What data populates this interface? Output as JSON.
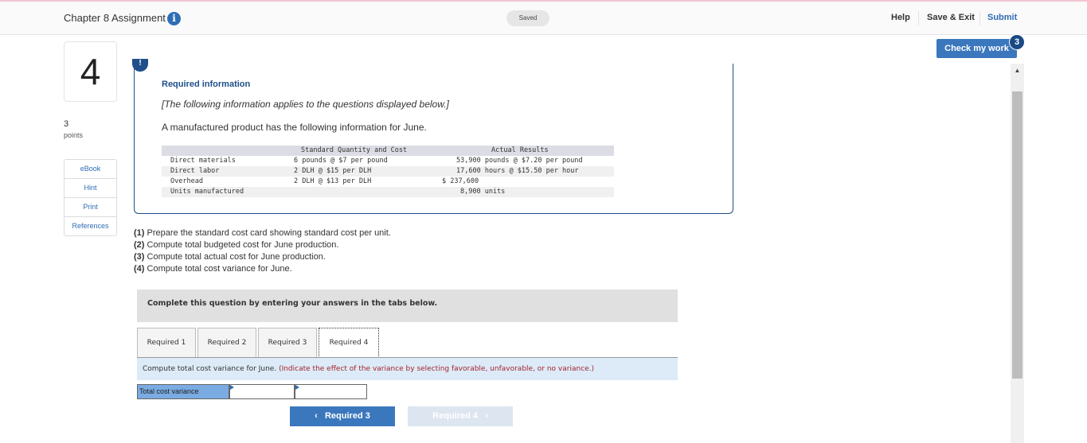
{
  "header": {
    "title": "Chapter 8 Assignment",
    "info_icon": "i",
    "status": "Saved",
    "links": [
      "Help",
      "Save & Exit",
      "Submit"
    ]
  },
  "check_work": {
    "label": "Check my work",
    "badge": "3"
  },
  "question": {
    "number": "4",
    "points_value": "3",
    "points_label": "points",
    "tools": [
      "eBook",
      "Hint",
      "Print",
      "References"
    ]
  },
  "required_info": {
    "alert_icon": "!",
    "heading": "Required information",
    "italic_note": "[The following information applies to the questions displayed below.]",
    "intro": "A manufactured product has the following information for June.",
    "table": {
      "headers": [
        "",
        "Standard Quantity and Cost",
        "Actual Results"
      ],
      "rows": [
        [
          "Direct materials",
          "6 pounds @ $7 per pound",
          "53,900 pounds @ $7.20 per pound"
        ],
        [
          "Direct labor",
          "2 DLH @ $15 per DLH",
          "17,600 hours @ $15.50 per hour"
        ],
        [
          "Overhead",
          "2 DLH @ $13 per DLH",
          "$ 237,600"
        ],
        [
          "Units manufactured",
          "",
          "8,900 units"
        ]
      ]
    }
  },
  "questions": [
    {
      "num": "(1)",
      "text": "Prepare the standard cost card showing standard cost per unit."
    },
    {
      "num": "(2)",
      "text": "Compute total budgeted cost for June production."
    },
    {
      "num": "(3)",
      "text": "Compute total actual cost for June production."
    },
    {
      "num": "(4)",
      "text": "Compute total cost variance for June."
    }
  ],
  "complete_instruction": "Complete this question by entering your answers in the tabs below.",
  "tabs": [
    {
      "label": "Required 1",
      "active": false
    },
    {
      "label": "Required 2",
      "active": false
    },
    {
      "label": "Required 3",
      "active": false
    },
    {
      "label": "Required 4",
      "active": true
    }
  ],
  "tab_instruction": {
    "lead": "Compute total cost variance for June.",
    "note": "(Indicate the effect of the variance by selecting favorable, unfavorable, or no variance.)"
  },
  "answer": {
    "label": "Total cost variance",
    "amount_value": "",
    "effect_value": ""
  },
  "nav": {
    "prev_label": "Required 3",
    "next_label": "Required 4",
    "prev_arrow": "‹",
    "next_arrow": "›"
  },
  "colors": {
    "accent": "#3b77bd",
    "dark_accent": "#1e4f8a",
    "note_red": "#a4232e",
    "answer_label_bg": "#7aabe2"
  }
}
